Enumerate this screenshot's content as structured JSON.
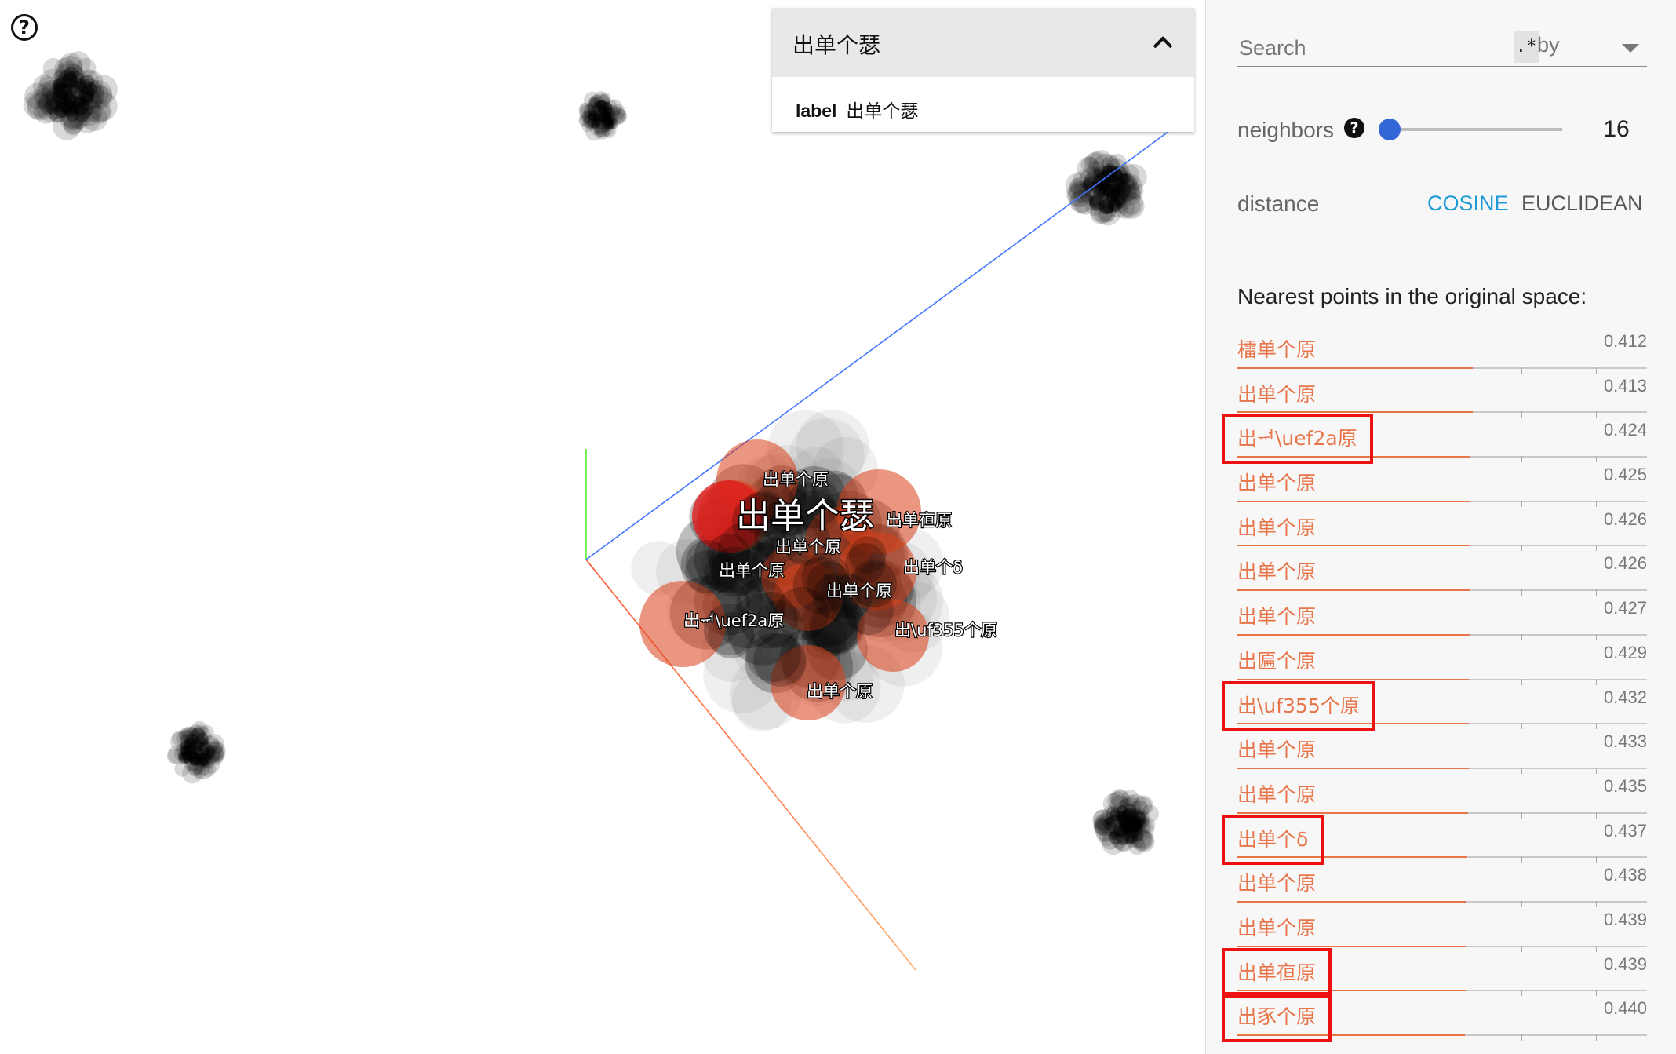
{
  "help_button": {
    "glyph": "?"
  },
  "tooltip": {
    "title": "出单个瑟",
    "field_key": "label",
    "field_value": "出单个瑟",
    "collapse_icon": "chevron-up-icon"
  },
  "scene": {
    "axis_colors": {
      "x": "#ff5533",
      "y": "#55ee33",
      "z": "#4477ff",
      "x_end": "#ffaa66"
    },
    "selected_label": "出单个瑟",
    "point_labels": [
      "出单个原",
      "出单个原",
      "出单亱原",
      "出单个原",
      "出单个δ",
      "出单个原",
      "出ᆏ\\uef2a原",
      "出\\uf355个原",
      "出单个原"
    ]
  },
  "panel": {
    "search": {
      "placeholder": "Search",
      "regex_label": ".*",
      "by_label": "by"
    },
    "neighbors": {
      "label": "neighbors",
      "help": "?",
      "value": "16",
      "slider_fraction": 0.0
    },
    "distance": {
      "label": "distance",
      "cosine": "COSINE",
      "euclidean": "EUCLIDEAN",
      "selected": "cosine"
    },
    "nearest_title": "Nearest points in the original space:",
    "accent_color": "#e8754a",
    "neighbors_list": [
      {
        "label": "檑单个原",
        "value": "0.412"
      },
      {
        "label": "出单个原",
        "value": "0.413"
      },
      {
        "label": "出ᆏ\\uef2a原",
        "value": "0.424",
        "highlighted": true
      },
      {
        "label": "出单个原",
        "value": "0.425"
      },
      {
        "label": "出单个原",
        "value": "0.426"
      },
      {
        "label": "出单个原",
        "value": "0.426"
      },
      {
        "label": "出单个原",
        "value": "0.427"
      },
      {
        "label": "出匾个原",
        "value": "0.429"
      },
      {
        "label": "出\\uf355个原",
        "value": "0.432",
        "highlighted": true
      },
      {
        "label": "出单个原",
        "value": "0.433"
      },
      {
        "label": "出单个原",
        "value": "0.435"
      },
      {
        "label": "出单个δ",
        "value": "0.437",
        "highlighted": true
      },
      {
        "label": "出单个原",
        "value": "0.438"
      },
      {
        "label": "出单个原",
        "value": "0.439"
      },
      {
        "label": "出单亱原",
        "value": "0.439",
        "highlighted": true
      },
      {
        "label": "出豕个原",
        "value": "0.440",
        "highlighted": true
      }
    ]
  }
}
